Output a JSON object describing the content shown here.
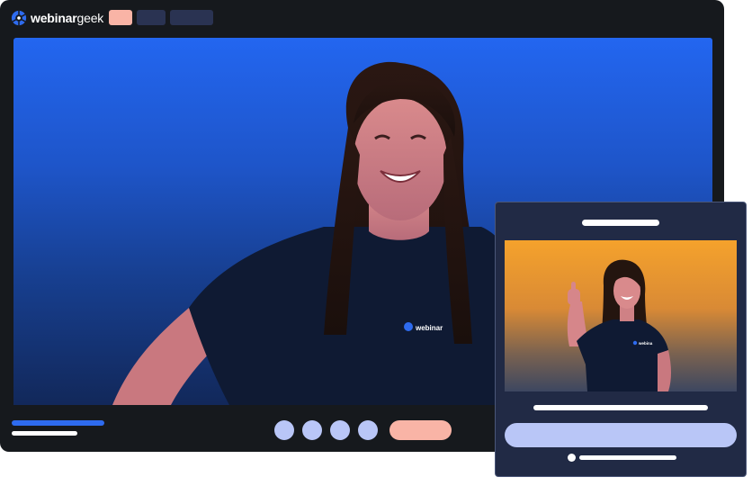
{
  "app": {
    "brand_bold": "webinar",
    "brand_light": "geek",
    "logo_icon": "webinargeek-logo-icon"
  },
  "colors": {
    "window_bg": "#16191d",
    "video_top": "#2366f0",
    "video_bottom": "#12285a",
    "accent_salmon": "#f9b4a6",
    "accent_lavender": "#b9c6f7",
    "nav_dark": "#2a3352",
    "popup_bg": "#212a45",
    "popup_video_top": "#f5a22c",
    "progress_blue": "#2e6bef"
  },
  "presenter": {
    "shirt_text": "webinar"
  },
  "popup": {
    "shirt_text": "webina"
  },
  "controls": {
    "icons": [
      "mic-icon",
      "camera-icon",
      "screen-share-icon",
      "settings-icon"
    ]
  }
}
